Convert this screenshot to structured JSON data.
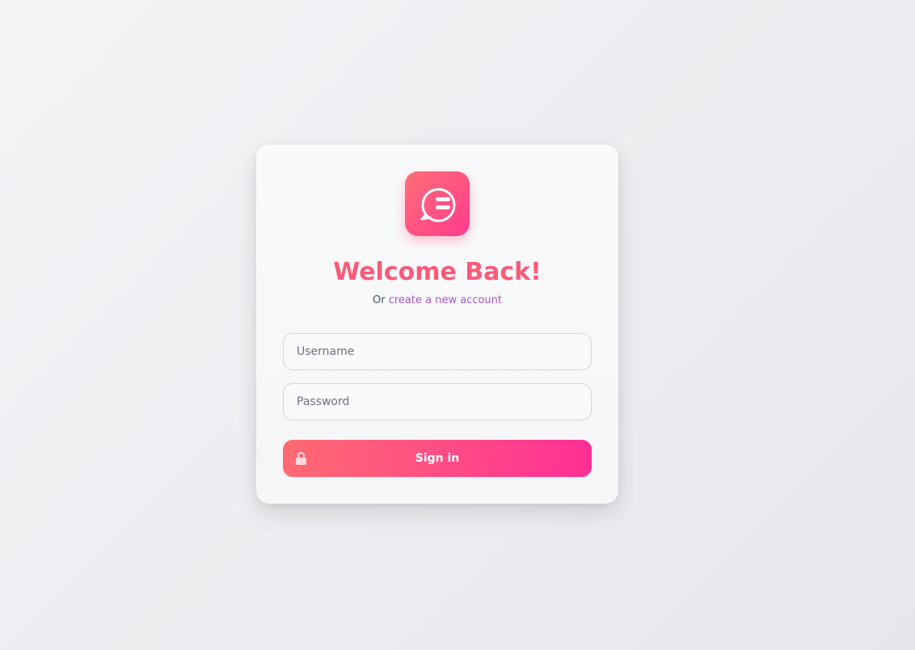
{
  "login": {
    "title": "Welcome Back!",
    "subtitle_prefix": "Or",
    "create_account_link": "create a new account",
    "username_placeholder": "Username",
    "password_placeholder": "Password",
    "sign_in_label": "Sign in"
  },
  "icons": {
    "logo": "chat-bubble-icon",
    "sign_in": "lock-icon"
  },
  "colors": {
    "accent_start": "#ff6f76",
    "accent_end": "#ff3b8e",
    "title": "#fb5a78",
    "link": "#a855c7"
  }
}
